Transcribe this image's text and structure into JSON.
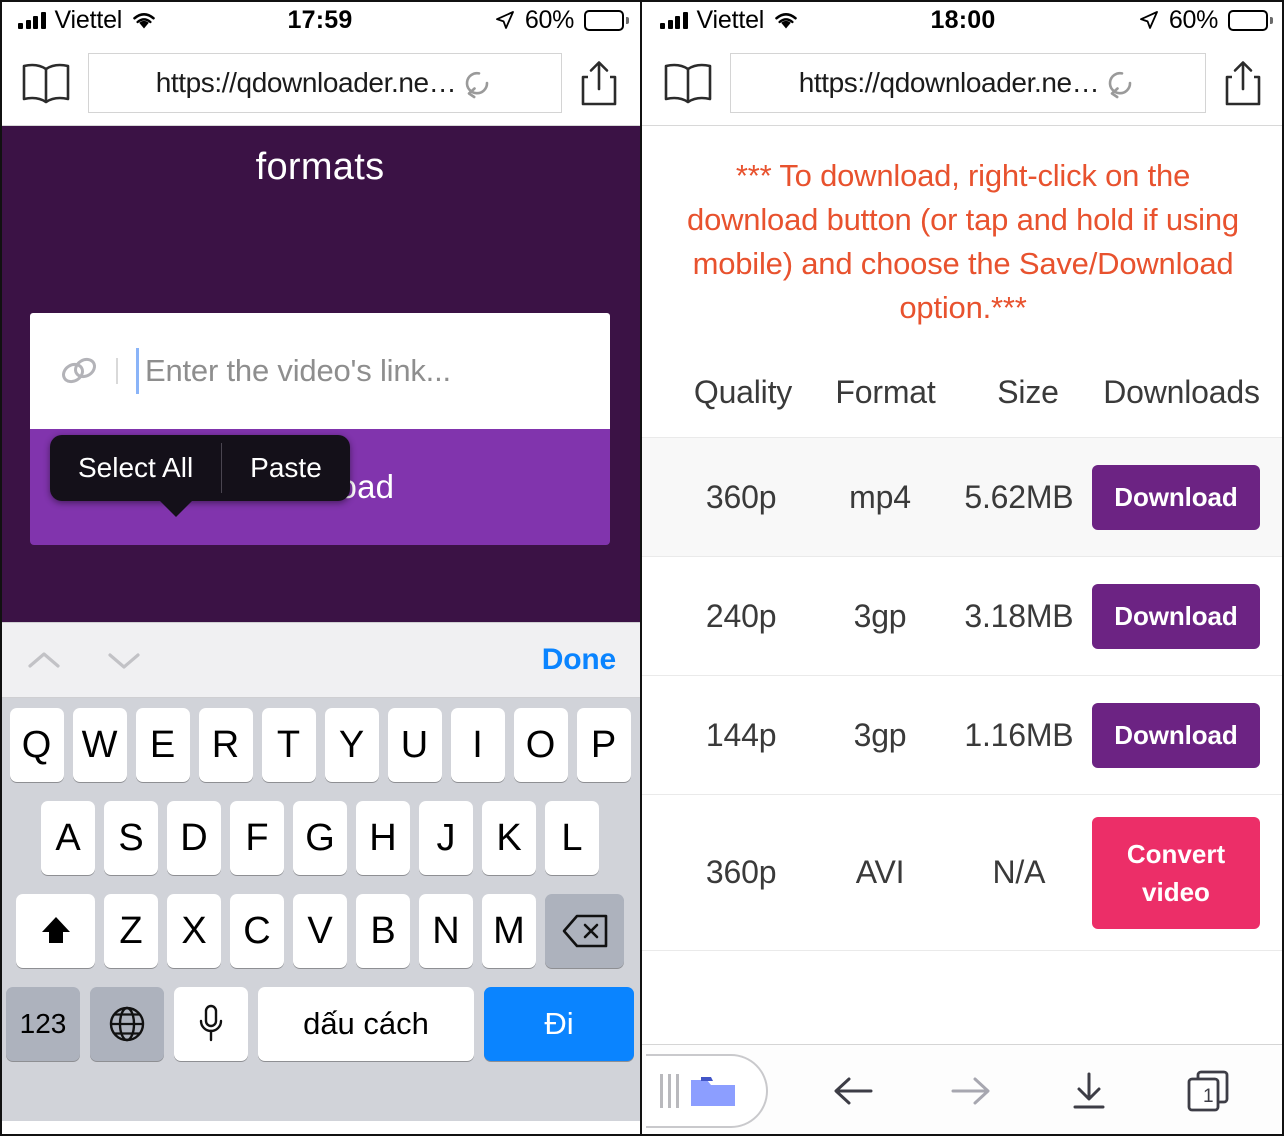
{
  "left": {
    "statusbar": {
      "carrier": "Viettel",
      "time": "17:59",
      "battery_percent": "60%",
      "signal_icon": "cellular-signal-icon",
      "wifi_icon": "wifi-icon",
      "location_icon": "location-arrow-icon",
      "battery_icon": "battery-icon"
    },
    "browser": {
      "bookmarks_icon": "book-icon",
      "url": "https://qdownloader.ne…",
      "reload_icon": "reload-icon",
      "share_icon": "share-icon"
    },
    "page": {
      "title": "formats",
      "context_menu": {
        "select_all": "Select All",
        "paste": "Paste"
      },
      "input": {
        "link_icon": "link-icon",
        "placeholder": "Enter the video's link..."
      },
      "download_label": "Download"
    },
    "accessory": {
      "prev_icon": "chevron-up-icon",
      "next_icon": "chevron-down-icon",
      "done": "Done"
    },
    "keyboard": {
      "row1": [
        "Q",
        "W",
        "E",
        "R",
        "T",
        "Y",
        "U",
        "I",
        "O",
        "P"
      ],
      "row2": [
        "A",
        "S",
        "D",
        "F",
        "G",
        "H",
        "J",
        "K",
        "L"
      ],
      "row3": [
        "Z",
        "X",
        "C",
        "V",
        "B",
        "N",
        "M"
      ],
      "shift_icon": "shift-arrow-icon",
      "delete_icon": "backspace-icon",
      "numbers": "123",
      "globe_icon": "globe-icon",
      "mic_icon": "microphone-icon",
      "space": "dấu cách",
      "go": "Đi"
    }
  },
  "right": {
    "statusbar": {
      "carrier": "Viettel",
      "time": "18:00",
      "battery_percent": "60%",
      "signal_icon": "cellular-signal-icon",
      "wifi_icon": "wifi-icon",
      "location_icon": "location-arrow-icon",
      "battery_icon": "battery-icon"
    },
    "browser": {
      "bookmarks_icon": "book-icon",
      "url": "https://qdownloader.ne…",
      "reload_icon": "reload-icon",
      "share_icon": "share-icon"
    },
    "notice": "*** To download, right-click on the download button (or tap and hold if using mobile) and choose the Save/Download option.***",
    "table": {
      "headers": [
        "Quality",
        "Format",
        "Size",
        "Downloads"
      ],
      "rows": [
        {
          "quality": "360p",
          "format": "mp4",
          "size": "5.62MB",
          "action": "Download",
          "action_type": "download"
        },
        {
          "quality": "240p",
          "format": "3gp",
          "size": "3.18MB",
          "action": "Download",
          "action_type": "download"
        },
        {
          "quality": "144p",
          "format": "3gp",
          "size": "1.16MB",
          "action": "Download",
          "action_type": "download"
        },
        {
          "quality": "360p",
          "format": "AVI",
          "size": "N/A",
          "action": "Convert video",
          "action_type": "convert"
        }
      ]
    },
    "bottombar": {
      "downloads_popup_icon": "folder-icon",
      "grip_icon": "drag-handle-icon",
      "back_icon": "arrow-left-icon",
      "forward_icon": "arrow-right-icon",
      "downloads_icon": "download-arrow-icon",
      "tabs_icon": "tabs-icon",
      "tab_count": "1"
    }
  },
  "colors": {
    "page_background": "#3b1245",
    "primary_button": "#8134ad",
    "table_button": "#6c2383",
    "convert_button": "#ec2e68",
    "notice_text": "#e8522e",
    "accent_blue": "#0a84ff"
  }
}
